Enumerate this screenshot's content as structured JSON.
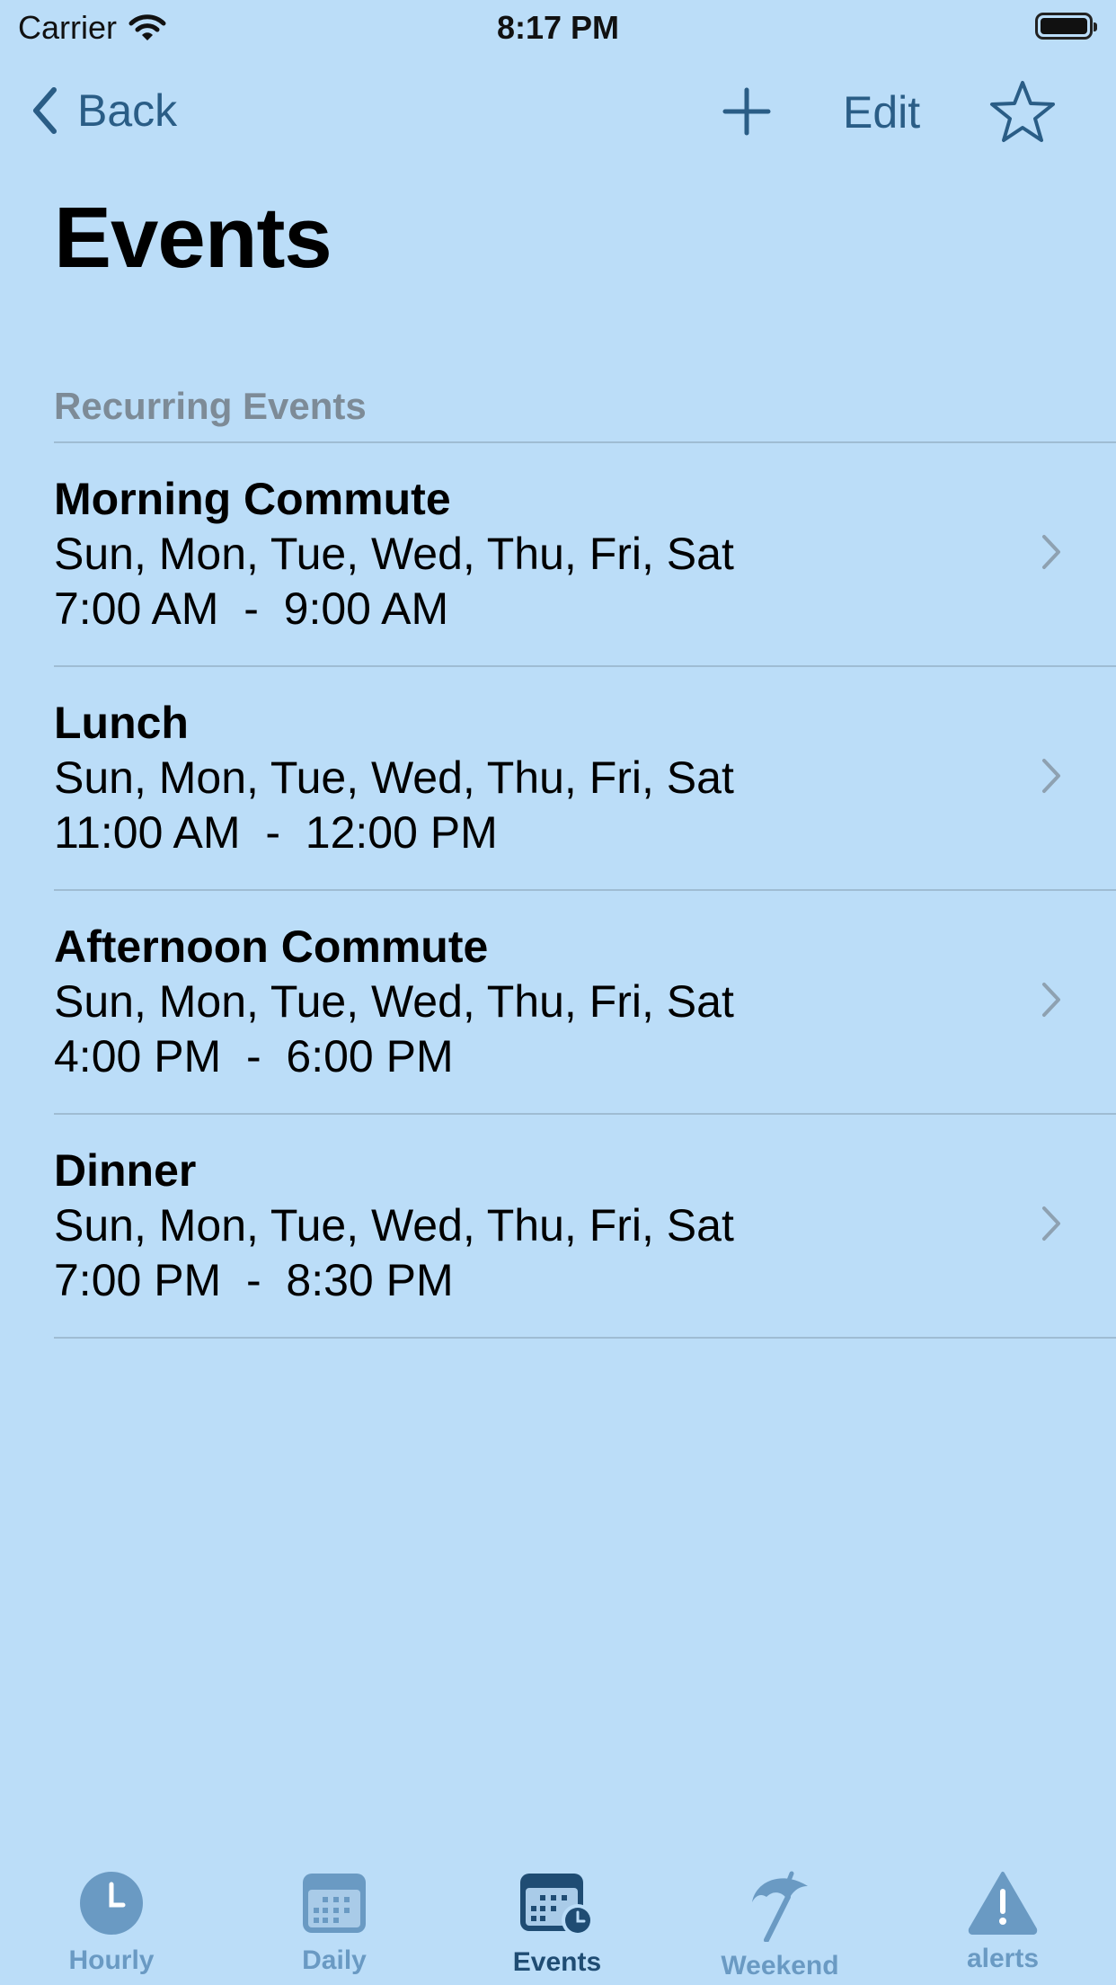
{
  "status_bar": {
    "carrier": "Carrier",
    "time": "8:17 PM"
  },
  "nav": {
    "back_label": "Back",
    "edit_label": "Edit"
  },
  "title": "Events",
  "section_header": "Recurring Events",
  "events": [
    {
      "title": "Morning Commute",
      "days": "Sun, Mon, Tue, Wed, Thu, Fri, Sat",
      "time": "7:00 AM  -  9:00 AM"
    },
    {
      "title": "Lunch",
      "days": "Sun, Mon, Tue, Wed, Thu, Fri, Sat",
      "time": "11:00 AM  -  12:00 PM"
    },
    {
      "title": "Afternoon Commute",
      "days": "Sun, Mon, Tue, Wed, Thu, Fri, Sat",
      "time": "4:00 PM  -  6:00 PM"
    },
    {
      "title": "Dinner",
      "days": "Sun, Mon, Tue, Wed, Thu, Fri, Sat",
      "time": "7:00 PM  -  8:30 PM"
    }
  ],
  "tabs": [
    {
      "label": "Hourly",
      "icon": "clock-icon"
    },
    {
      "label": "Daily",
      "icon": "calendar-icon"
    },
    {
      "label": "Events",
      "icon": "calendar-clock-icon",
      "active": true
    },
    {
      "label": "Weekend",
      "icon": "beach-umbrella-icon"
    },
    {
      "label": "alerts",
      "icon": "warning-icon"
    }
  ],
  "colors": {
    "background": "#bbddf8",
    "accent": "#2a5d86",
    "tab_inactive": "#6a9ac3",
    "tab_active": "#1f4c73"
  }
}
